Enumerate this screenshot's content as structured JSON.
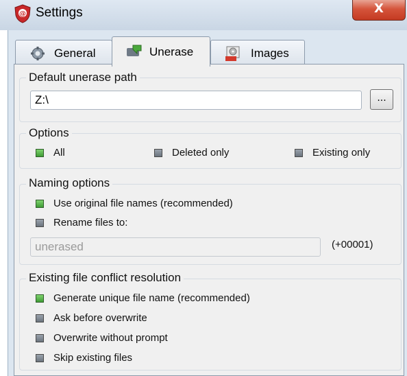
{
  "window": {
    "title": "Settings",
    "close_label": "X"
  },
  "tabs": [
    {
      "label": "General",
      "icon": "gear-icon"
    },
    {
      "label": "Unerase",
      "icon": "disk-arrow-icon",
      "active": true
    },
    {
      "label": "Images",
      "icon": "disk-image-icon"
    }
  ],
  "default_path": {
    "legend": "Default unerase path",
    "value": "Z:\\",
    "browse_label": "..."
  },
  "options": {
    "legend": "Options",
    "items": [
      {
        "label": "All",
        "checked": true
      },
      {
        "label": "Deleted only",
        "checked": false
      },
      {
        "label": "Existing only",
        "checked": false
      }
    ]
  },
  "naming": {
    "legend": "Naming options",
    "items": [
      {
        "label": "Use original file names (recommended)",
        "checked": true
      },
      {
        "label": "Rename files to:",
        "checked": false
      }
    ],
    "rename_value": "unerased",
    "suffix": "(+00001)"
  },
  "conflict": {
    "legend": "Existing file conflict resolution",
    "items": [
      {
        "label": "Generate unique file name (recommended)",
        "checked": true
      },
      {
        "label": "Ask before overwrite",
        "checked": false
      },
      {
        "label": "Overwrite without prompt",
        "checked": false
      },
      {
        "label": "Skip existing files",
        "checked": false
      }
    ]
  },
  "colors": {
    "checked": "#4caf3f",
    "unchecked": "#7a838c",
    "close_button": "#d5543b"
  }
}
